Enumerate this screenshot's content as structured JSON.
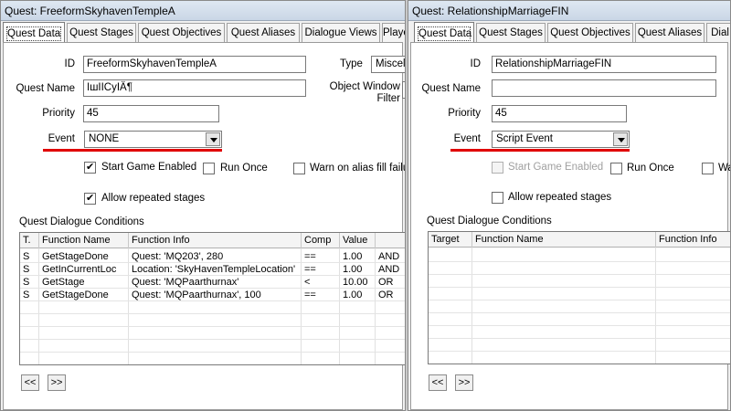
{
  "left": {
    "title": "Quest: FreeformSkyhavenTempleA",
    "tabs": [
      "Quest Data",
      "Quest Stages",
      "Quest Objectives",
      "Quest Aliases",
      "Dialogue Views",
      "Playe"
    ],
    "labels": {
      "id": "ID",
      "quest_name": "Quest Name",
      "priority": "Priority",
      "event": "Event",
      "type": "Type",
      "owf_line1": "Object Window",
      "owf_line2": "Filter"
    },
    "values": {
      "id": "FreeformSkyhavenTempleA",
      "quest_name": "ІшІІCуІÄ¶",
      "priority": "45",
      "event": "NONE",
      "type": "Miscell"
    },
    "checkboxes": [
      {
        "label": "Start Game Enabled",
        "checked": true
      },
      {
        "label": "Run Once",
        "checked": false
      },
      {
        "label": "Warn on alias fill failure",
        "checked": false
      },
      {
        "label": "Allow repeated stages",
        "checked": true
      }
    ],
    "conditions_label": "Quest Dialogue Conditions",
    "grid_headers": [
      "T.",
      "Function Name",
      "Function Info",
      "Comp",
      "Value",
      ""
    ],
    "grid_rows": [
      [
        "S",
        "GetStageDone",
        "Quest: 'MQ203', 280",
        "==",
        "1.00",
        "AND"
      ],
      [
        "S",
        "GetInCurrentLoc",
        "Location: 'SkyHavenTempleLocation'",
        "==",
        "1.00",
        "AND"
      ],
      [
        "S",
        "GetStage",
        "Quest: 'MQPaarthurnax'",
        "<",
        "10.00",
        "OR"
      ],
      [
        "S",
        "GetStageDone",
        "Quest: 'MQPaarthurnax', 100",
        "==",
        "1.00",
        "OR"
      ]
    ],
    "nav": [
      "<<",
      ">>"
    ]
  },
  "right": {
    "title": "Quest: RelationshipMarriageFIN",
    "tabs": [
      "Quest Data",
      "Quest Stages",
      "Quest Objectives",
      "Quest Aliases",
      "Dial"
    ],
    "labels": {
      "id": "ID",
      "quest_name": "Quest Name",
      "priority": "Priority",
      "event": "Event"
    },
    "values": {
      "id": "RelationshipMarriageFIN",
      "quest_name": "",
      "priority": "45",
      "event": "Script Event"
    },
    "checkboxes": [
      {
        "label": "Start Game Enabled",
        "checked": false,
        "disabled": true
      },
      {
        "label": "Run Once",
        "checked": false
      },
      {
        "label": "Wa",
        "checked": false
      },
      {
        "label": "Allow repeated stages",
        "checked": false
      }
    ],
    "conditions_label": "Quest Dialogue Conditions",
    "grid_headers": [
      "Target",
      "Function Name",
      "Function Info"
    ],
    "nav": [
      "<<",
      ">>"
    ]
  },
  "colors": {
    "highlight_underline": "#e00000"
  }
}
